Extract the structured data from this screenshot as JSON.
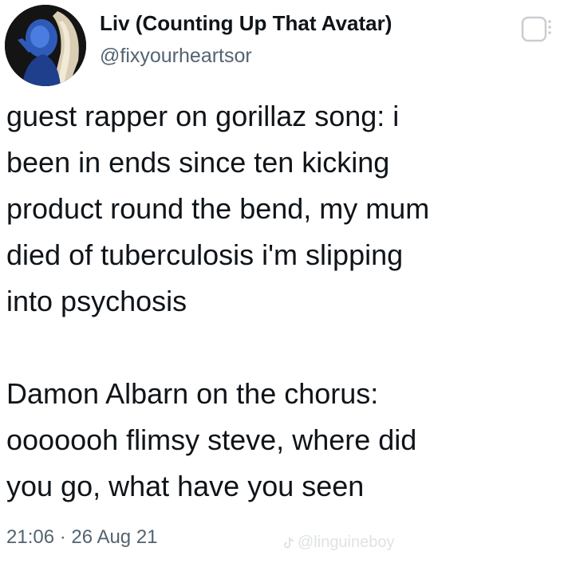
{
  "author": {
    "display_name": "Liv (Counting Up That Avatar)",
    "handle": "@fixyourheartsor"
  },
  "tweet": {
    "paragraph_1": "guest rapper on gorillaz song: i\nbeen in ends since ten kicking\nproduct round the bend, my mum\ndied of tuberculosis i'm slipping\ninto psychosis",
    "paragraph_2": "Damon Albarn on the chorus:\nooooooh flimsy steve, where did\nyou go, what have you seen",
    "time": "21:06",
    "separator": "·",
    "date": "26 Aug 21"
  },
  "watermark": {
    "text": "@linguineboy",
    "icon": "tiktok-icon"
  },
  "icons": {
    "avatar": "avatar-image",
    "menu": "more-options-icon"
  },
  "colors": {
    "text": "#0f1419",
    "secondary": "#536471",
    "background": "#ffffff"
  }
}
